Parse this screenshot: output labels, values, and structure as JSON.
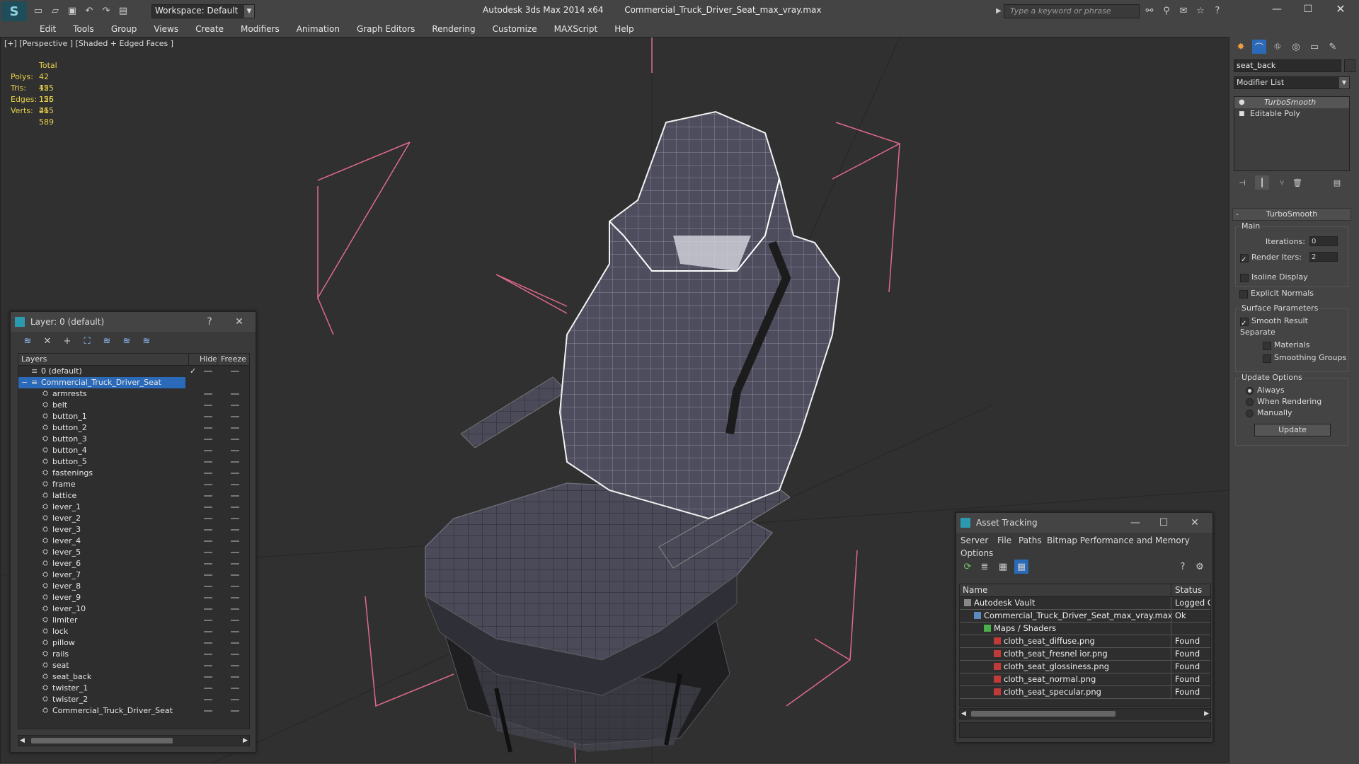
{
  "app": {
    "title": "Autodesk 3ds Max  2014 x64",
    "filename": "Commercial_Truck_Driver_Seat_max_vray.max",
    "workspace": "Workspace: Default",
    "search_placeholder": "Type a keyword or phrase"
  },
  "menu": [
    "Edit",
    "Tools",
    "Group",
    "Views",
    "Create",
    "Modifiers",
    "Animation",
    "Graph Editors",
    "Rendering",
    "Customize",
    "MAXScript",
    "Help"
  ],
  "viewport": {
    "label": "[+] [Perspective ] [Shaded + Edged Faces ]",
    "stats": {
      "header": "Total",
      "rows": [
        {
          "label": "Polys:",
          "value": "42 155"
        },
        {
          "label": "Tris:",
          "value": "42 155"
        },
        {
          "label": "Edges:",
          "value": "126 465"
        },
        {
          "label": "Verts:",
          "value": "21 589"
        }
      ]
    }
  },
  "layer_panel": {
    "title": "Layer: 0 (default)",
    "help": "?",
    "columns": {
      "layers": "Layers",
      "hide": "Hide",
      "freeze": "Freeze"
    },
    "default_layer": "0 (default)",
    "selected_layer": "Commercial_Truck_Driver_Seat",
    "items": [
      "armrests",
      "belt",
      "button_1",
      "button_2",
      "button_3",
      "button_4",
      "button_5",
      "fastenings",
      "frame",
      "lattice",
      "lever_1",
      "lever_2",
      "lever_3",
      "lever_4",
      "lever_5",
      "lever_6",
      "lever_7",
      "lever_8",
      "lever_9",
      "lever_10",
      "limiter",
      "lock",
      "pillow",
      "rails",
      "seat",
      "seat_back",
      "twister_1",
      "twister_2",
      "Commercial_Truck_Driver_Seat"
    ]
  },
  "asset_tracking": {
    "title": "Asset Tracking",
    "menu": [
      "Server",
      "File",
      "Paths",
      "Bitmap Performance and Memory",
      "Options"
    ],
    "columns": {
      "name": "Name",
      "status": "Status"
    },
    "rows": [
      {
        "name": "Autodesk Vault",
        "status": "Logged O",
        "indent": 1
      },
      {
        "name": "Commercial_Truck_Driver_Seat_max_vray.max",
        "status": "Ok",
        "indent": 2
      },
      {
        "name": "Maps / Shaders",
        "status": "",
        "indent": 3
      },
      {
        "name": "cloth_seat_diffuse.png",
        "status": "Found",
        "indent": 4
      },
      {
        "name": "cloth_seat_fresnel ior.png",
        "status": "Found",
        "indent": 4
      },
      {
        "name": "cloth_seat_glossiness.png",
        "status": "Found",
        "indent": 4
      },
      {
        "name": "cloth_seat_normal.png",
        "status": "Found",
        "indent": 4
      },
      {
        "name": "cloth_seat_specular.png",
        "status": "Found",
        "indent": 4
      }
    ]
  },
  "command_panel": {
    "object_name": "seat_back",
    "modifier_list": "Modifier List",
    "stack": [
      "TurboSmooth",
      "Editable Poly"
    ],
    "rollout_title": "TurboSmooth",
    "main_label": "Main",
    "iterations_label": "Iterations:",
    "iterations_value": "0",
    "render_iters_label": "Render Iters:",
    "render_iters_value": "2",
    "isoline": "Isoline Display",
    "explicit_normals": "Explicit Normals",
    "surface_params": "Surface Parameters",
    "smooth_result": "Smooth Result",
    "separate": "Separate",
    "materials": "Materials",
    "smoothing_groups": "Smoothing Groups",
    "update_options": "Update Options",
    "always": "Always",
    "when_rendering": "When Rendering",
    "manually": "Manually",
    "update_btn": "Update"
  },
  "colors": {
    "accent": "#1e73d6",
    "selected_row": "#2a6ab8",
    "stats_yellow": "#e8d24a",
    "bbox_pink": "#e06a8a"
  }
}
